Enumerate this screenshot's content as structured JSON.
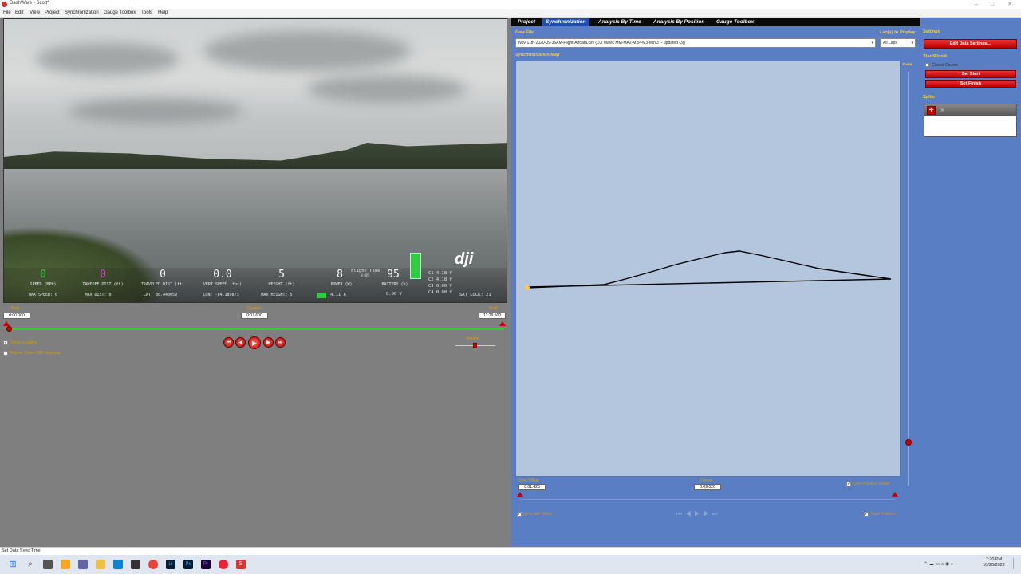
{
  "window": {
    "title": "DashWare - Scott*"
  },
  "menu": [
    "File",
    "Edit",
    "View",
    "Project",
    "Synchronization",
    "Gauge Toolbox",
    "Tools",
    "Help"
  ],
  "osd": {
    "speed": {
      "value": "0",
      "label": "SPEED (MPH)",
      "sub": "MAX SPEED: 0"
    },
    "takeoff": {
      "value": "0",
      "label": "TAKEOFF DIST (ft)",
      "sub": "MAX DIST: 0"
    },
    "traveled": {
      "value": "0",
      "label": "TRAVELED DIST (ft)",
      "sub": "LAT: 30.440059"
    },
    "vert": {
      "value": "0.0",
      "label": "VERT SPEED (fps)",
      "sub": "LON: -84.189873"
    },
    "height": {
      "value": "5",
      "label": "HEIGHT (ft)",
      "sub": "MAX HEIGHT: 5"
    },
    "power": {
      "value": "8",
      "label": "POWER (W)",
      "sub": "4.11 A"
    },
    "flight_time": {
      "label": "Flight Time",
      "value": "0:05"
    },
    "battery": {
      "value": "95",
      "label": "BATTERY (%)",
      "sub": "0.00 V"
    },
    "cells": [
      "C1 4.18 V",
      "C2 4.18 V",
      "C3 0.00 V",
      "C4 0.00 V"
    ],
    "sat": "SAT LOCK: 21",
    "logo": "dji"
  },
  "timeline": {
    "start_label": "Start",
    "start_value": "0:00.000",
    "current_label": "Current",
    "current_value": "0:07.600",
    "end_label": "End",
    "end_value": "13:29.500",
    "volume_label": "Volume",
    "show_gauges": "Show Gauges",
    "rotate_video": "Rotate Video 180 degrees"
  },
  "tabs": [
    "Project",
    "Synchronization",
    "Analysis By Time",
    "Analysis By Position",
    "Gauge Toolbox"
  ],
  "sync": {
    "data_file_label": "Data File",
    "data_file_value": "Nov-11th-2020-09-36AM-Flight-Airdata.csv (DJI Mavic MM-MA2-M2P-M3-Mini3 -- updated (3))",
    "laps_label": "Lap(s) to Display",
    "laps_value": "All Laps",
    "map_label": "Synchronization Map",
    "zoom_label": "Zoom",
    "sync_offset_label": "Sync Offset",
    "sync_offset_value": "0:01.425",
    "current_label": "Current",
    "current_value": "0:09.026",
    "keep_visible": "Keep Position Visible",
    "sync_with_video": "Sync with Video",
    "track_position": "Track Position"
  },
  "settings": {
    "label": "Settings",
    "edit_button": "Edit Data Settings...",
    "startfinish_label": "Start/Finish",
    "closed_course": "Closed Course",
    "set_start": "Set Start",
    "set_finish": "Set Finish",
    "splits_label": "Splits"
  },
  "status": {
    "text": "Set Data Sync Time"
  },
  "clock": {
    "time": "7:20 PM",
    "date": "10/20/2022"
  }
}
